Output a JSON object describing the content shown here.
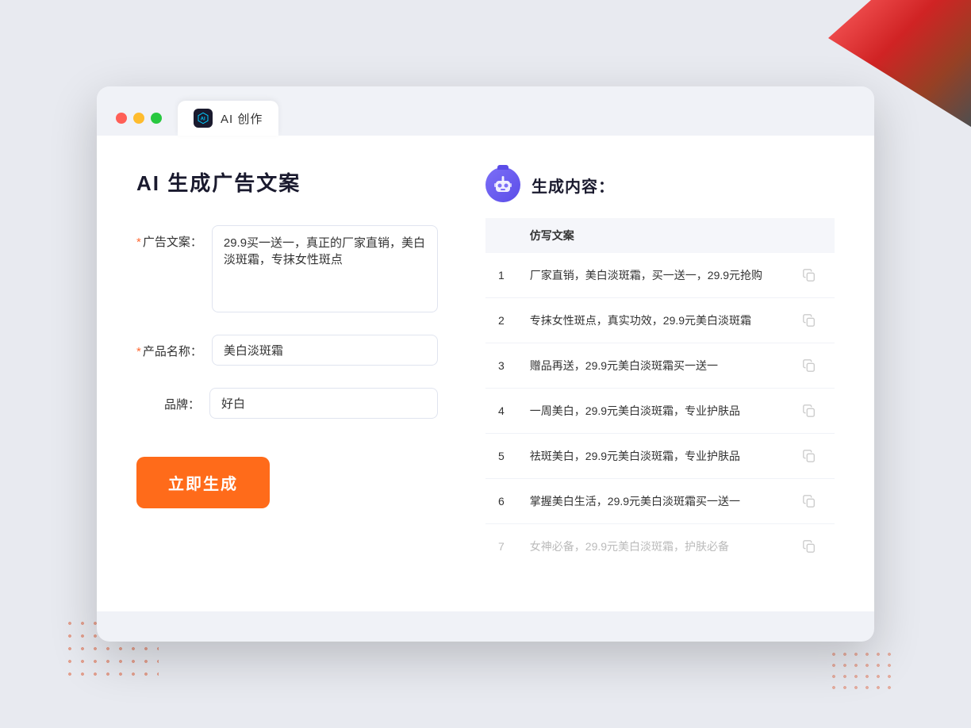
{
  "window": {
    "tab_title": "AI 创作"
  },
  "page": {
    "title": "AI 生成广告文案"
  },
  "form": {
    "ad_copy_label": "广告文案：",
    "ad_copy_required": "*",
    "ad_copy_value": "29.9买一送一，真正的厂家直销，美白淡斑霜，专抹女性斑点",
    "product_name_label": "产品名称：",
    "product_name_required": "*",
    "product_name_value": "美白淡斑霜",
    "brand_label": "品牌：",
    "brand_value": "好白",
    "generate_button": "立即生成"
  },
  "result": {
    "header_icon_label": "AI机器人",
    "title": "生成内容：",
    "column_header": "仿写文案",
    "items": [
      {
        "num": "1",
        "text": "厂家直销，美白淡斑霜，买一送一，29.9元抢购",
        "dim": false
      },
      {
        "num": "2",
        "text": "专抹女性斑点，真实功效，29.9元美白淡斑霜",
        "dim": false
      },
      {
        "num": "3",
        "text": "赠品再送，29.9元美白淡斑霜买一送一",
        "dim": false
      },
      {
        "num": "4",
        "text": "一周美白，29.9元美白淡斑霜，专业护肤品",
        "dim": false
      },
      {
        "num": "5",
        "text": "祛斑美白，29.9元美白淡斑霜，专业护肤品",
        "dim": false
      },
      {
        "num": "6",
        "text": "掌握美白生活，29.9元美白淡斑霜买一送一",
        "dim": false
      },
      {
        "num": "7",
        "text": "女神必备，29.9元美白淡斑霜，护肤必备",
        "dim": true
      }
    ]
  },
  "colors": {
    "accent_orange": "#ff6b1a",
    "accent_purple": "#6b5de8",
    "required_red": "#ff6b35"
  }
}
